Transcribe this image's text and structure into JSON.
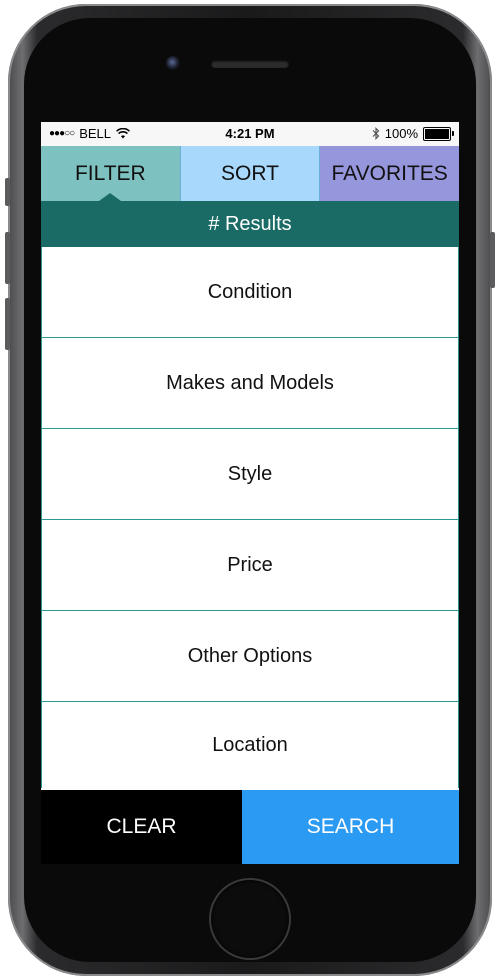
{
  "status_bar": {
    "carrier": "BELL",
    "time": "4:21 PM",
    "battery_percent": "100%"
  },
  "tabs": [
    {
      "label": "FILTER",
      "active": true,
      "color": "#7dc2c0"
    },
    {
      "label": "SORT",
      "active": false,
      "color": "#a8d8fc"
    },
    {
      "label": "FAVORITES",
      "active": false,
      "color": "#9696dc"
    }
  ],
  "results": {
    "label": "# Results",
    "color": "#1a6b66"
  },
  "filters": [
    {
      "label": "Condition"
    },
    {
      "label": "Makes and Models"
    },
    {
      "label": "Style"
    },
    {
      "label": "Price"
    },
    {
      "label": "Other Options"
    },
    {
      "label": "Location"
    }
  ],
  "actions": {
    "clear_label": "CLEAR",
    "search_label": "SEARCH",
    "search_color": "#2b9af3"
  },
  "icons": [
    "signal-dots-icon",
    "wifi-icon",
    "bluetooth-icon",
    "battery-icon"
  ]
}
